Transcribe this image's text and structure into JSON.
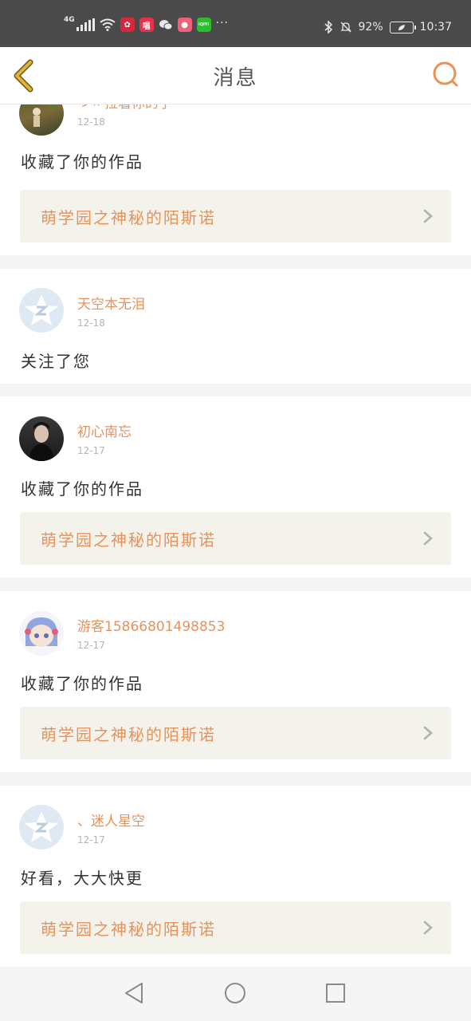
{
  "status_bar": {
    "network": "4G",
    "battery": "92%",
    "time": "10:37",
    "app_icons": [
      {
        "name": "huawei-app-icon",
        "label": "",
        "color": "#d7263d"
      },
      {
        "name": "changba-app-icon",
        "label": "唱",
        "color": "#e8314a"
      },
      {
        "name": "wechat-app-icon",
        "label": "",
        "color": "#4a4a4a"
      },
      {
        "name": "pig-app-icon",
        "label": "",
        "color": "#f0607a"
      },
      {
        "name": "iqiyi-app-icon",
        "label": "iQIYI",
        "color": "#2bbd2e"
      }
    ],
    "more": "···"
  },
  "header": {
    "title": "消息"
  },
  "colors": {
    "accent": "#e8925a",
    "back_arrow": "#e2b33b",
    "work_card_bg": "#f3f3ec"
  },
  "messages": [
    {
      "user": "ゞ〃拉着你的手丶",
      "date": "12-18",
      "action": "收藏了你的作品",
      "work": "萌学园之神秘的陌斯诺",
      "avatar": "photo-avatar-nature"
    },
    {
      "user": "天空本无泪",
      "date": "12-18",
      "action": "关注了您",
      "work": "",
      "avatar": "default-avatar"
    },
    {
      "user": "初心南忘",
      "date": "12-17",
      "action": "收藏了你的作品",
      "work": "萌学园之神秘的陌斯诺",
      "avatar": "photo-avatar-person"
    },
    {
      "user": "游客15866801498853",
      "date": "12-17",
      "action": "收藏了你的作品",
      "work": "萌学园之神秘的陌斯诺",
      "avatar": "anime-avatar"
    },
    {
      "user": "、迷人星空",
      "date": "12-17",
      "action": "好看，大大快更",
      "work": "萌学园之神秘的陌斯诺",
      "avatar": "default-avatar"
    }
  ]
}
